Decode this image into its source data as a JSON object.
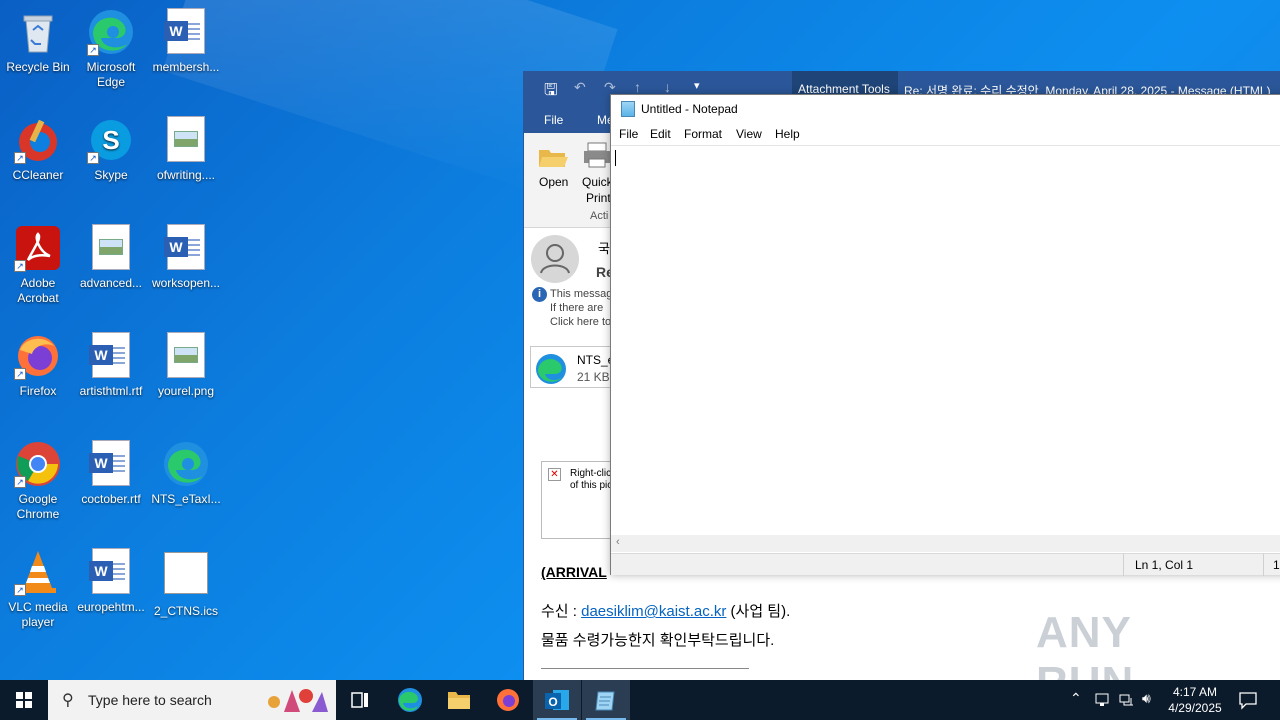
{
  "desktop": {
    "icons": [
      {
        "label": "Recycle Bin"
      },
      {
        "label": "Microsoft Edge"
      },
      {
        "label": "membersh..."
      },
      {
        "label": "CCleaner"
      },
      {
        "label": "Skype"
      },
      {
        "label": "ofwriting...."
      },
      {
        "label": "Adobe Acrobat"
      },
      {
        "label": "advanced..."
      },
      {
        "label": "worksopen..."
      },
      {
        "label": "Firefox"
      },
      {
        "label": "artisthtml.rtf"
      },
      {
        "label": "yourel.png"
      },
      {
        "label": "Google Chrome"
      },
      {
        "label": "coctober.rtf"
      },
      {
        "label": "NTS_eTaxI..."
      },
      {
        "label": "VLC media player"
      },
      {
        "label": "europehtm..."
      },
      {
        "label": "2_CTNS.ics"
      }
    ]
  },
  "outlook": {
    "context_tab": "Attachment Tools",
    "title": "Re: 서명 완료: 수리 수정안_Monday, April 28, 2025 - Message (HTML)",
    "tabs": {
      "file": "File",
      "message": "Me"
    },
    "ribbon": {
      "open": "Open",
      "quick_print_1": "Quick",
      "quick_print_2": "Print",
      "group": "Acti"
    },
    "sender_line": "국",
    "subject_fragment": "Re",
    "info_lines": [
      "This messag",
      "If there are",
      "Click here to"
    ],
    "attachment": {
      "name": "NTS_e",
      "size": "21 KB"
    },
    "image_placeholder": [
      "Right-clic",
      "of this pic"
    ],
    "arrival": "(ARRIVAL",
    "recipient_prefix": "수신 : ",
    "recipient_email": "daesiklim@kaist.ac.kr",
    "recipient_suffix": " (사업 팀).",
    "request_line": "물품 수령가능한지 확인부탁드립니다."
  },
  "notepad": {
    "title": "Untitled - Notepad",
    "menu": [
      "File",
      "Edit",
      "Format",
      "View",
      "Help"
    ],
    "status_position": "Ln 1, Col 1",
    "status_zoom": "1("
  },
  "taskbar": {
    "search_placeholder": "Type here to search",
    "time": "4:17 AM",
    "date": "4/29/2025"
  },
  "watermark": "ANY RUN"
}
